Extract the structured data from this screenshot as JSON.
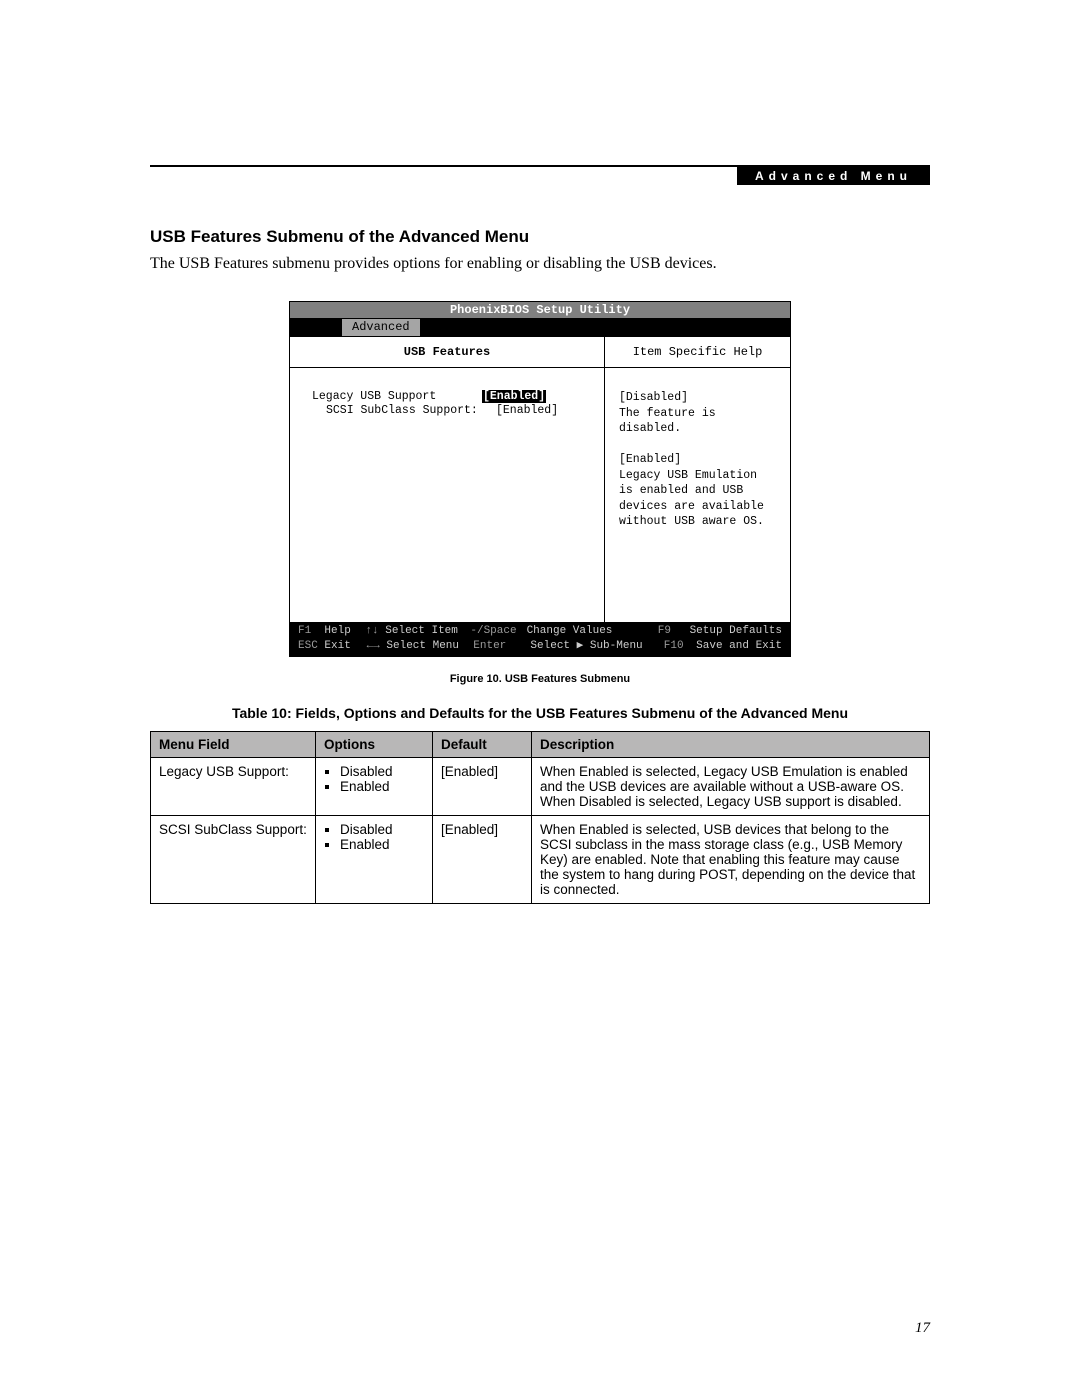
{
  "header": {
    "tab_label": "Advanced Menu"
  },
  "section": {
    "title": "USB Features Submenu of the Advanced Menu",
    "intro": "The USB Features submenu provides options for enabling or disabling the USB devices."
  },
  "bios": {
    "utility_title": "PhoenixBIOS Setup Utility",
    "active_menu": "Advanced",
    "left_heading": "USB Features",
    "right_heading": "Item Specific Help",
    "settings": [
      {
        "label": "Legacy USB Support",
        "value": "[Enabled]",
        "highlight": true,
        "indent": 0
      },
      {
        "label": "SCSI SubClass Support:",
        "value": "[Enabled]",
        "highlight": false,
        "indent": 2
      }
    ],
    "help_text": "[Disabled]\nThe feature is disabled.\n\n[Enabled]\nLegacy USB Emulation\nis enabled and USB\ndevices are available\nwithout USB aware OS.",
    "footer": {
      "row1": {
        "key1": "F1",
        "lbl1": "Help",
        "key2": "↑↓",
        "lbl2": "Select Item",
        "key3": "-/Space",
        "lbl3": "Change Values",
        "key4": "F9",
        "lbl4": "Setup Defaults"
      },
      "row2": {
        "key1": "ESC",
        "lbl1": "Exit",
        "key2": "←→",
        "lbl2": "Select Menu",
        "key3": "Enter",
        "lbl3": "Select ▶ Sub-Menu",
        "key4": "F10",
        "lbl4": "Save and Exit"
      }
    }
  },
  "figure_caption": "Figure 10.  USB Features Submenu",
  "table_caption": "Table 10: Fields, Options and Defaults for the USB Features Submenu of the Advanced Menu",
  "table": {
    "headers": {
      "menu_field": "Menu Field",
      "options": "Options",
      "default": "Default",
      "description": "Description"
    },
    "rows": [
      {
        "menu_field": "Legacy USB Support:",
        "options": [
          "Disabled",
          "Enabled"
        ],
        "default": "[Enabled]",
        "description": "When Enabled is selected, Legacy USB Emulation is enabled and the USB devices are available without a USB-aware OS. When Disabled is selected, Legacy USB support is disabled."
      },
      {
        "menu_field": "SCSI SubClass Support:",
        "options": [
          "Disabled",
          "Enabled"
        ],
        "default": "[Enabled]",
        "description": "When Enabled is selected, USB devices that belong to the SCSI subclass in the mass storage class (e.g., USB Memory Key) are enabled. Note that enabling this feature may cause the system to hang during POST, depending on the device that is connected."
      }
    ]
  },
  "page_number": "17"
}
